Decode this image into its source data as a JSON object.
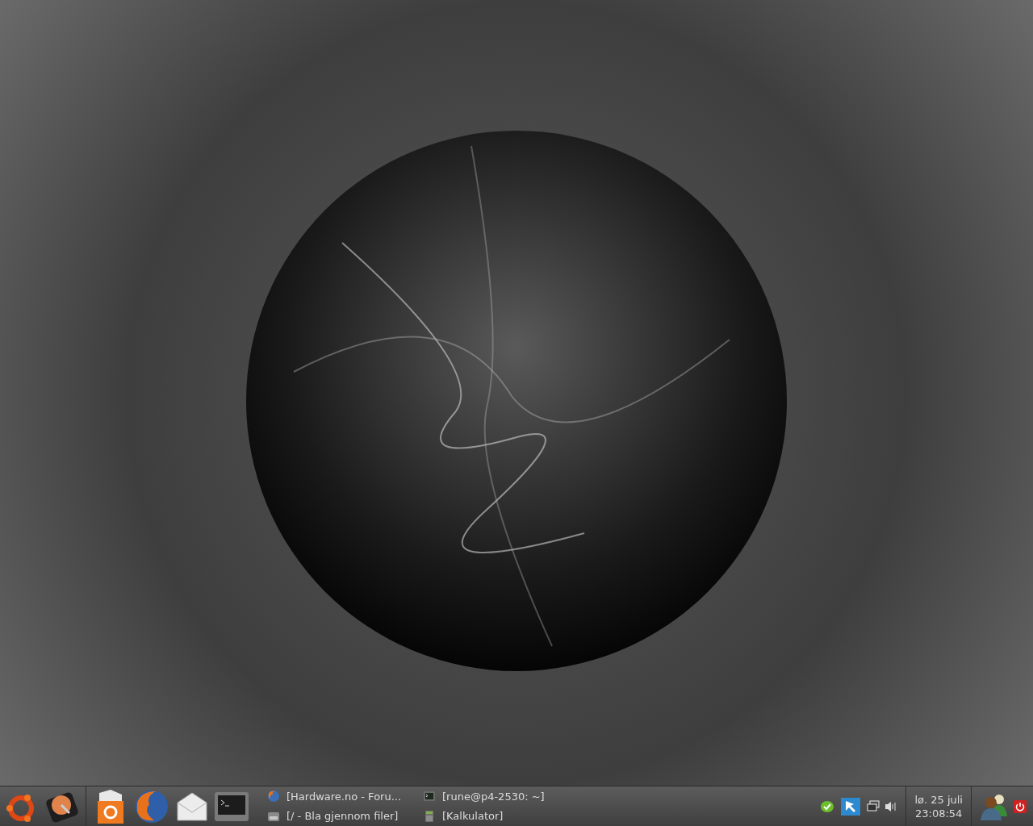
{
  "taskbar": {
    "tasks": [
      {
        "kind": "browser",
        "label": "[Hardware.no - Foru..."
      },
      {
        "kind": "files",
        "label": "[/ - Bla gjennom filer]"
      },
      {
        "kind": "terminal",
        "label": "[rune@p4-2530: ~]"
      },
      {
        "kind": "calculator",
        "label": "[Kalkulator]"
      }
    ],
    "clock": {
      "date": "lø. 25 juli",
      "time": "23:08:54"
    }
  }
}
